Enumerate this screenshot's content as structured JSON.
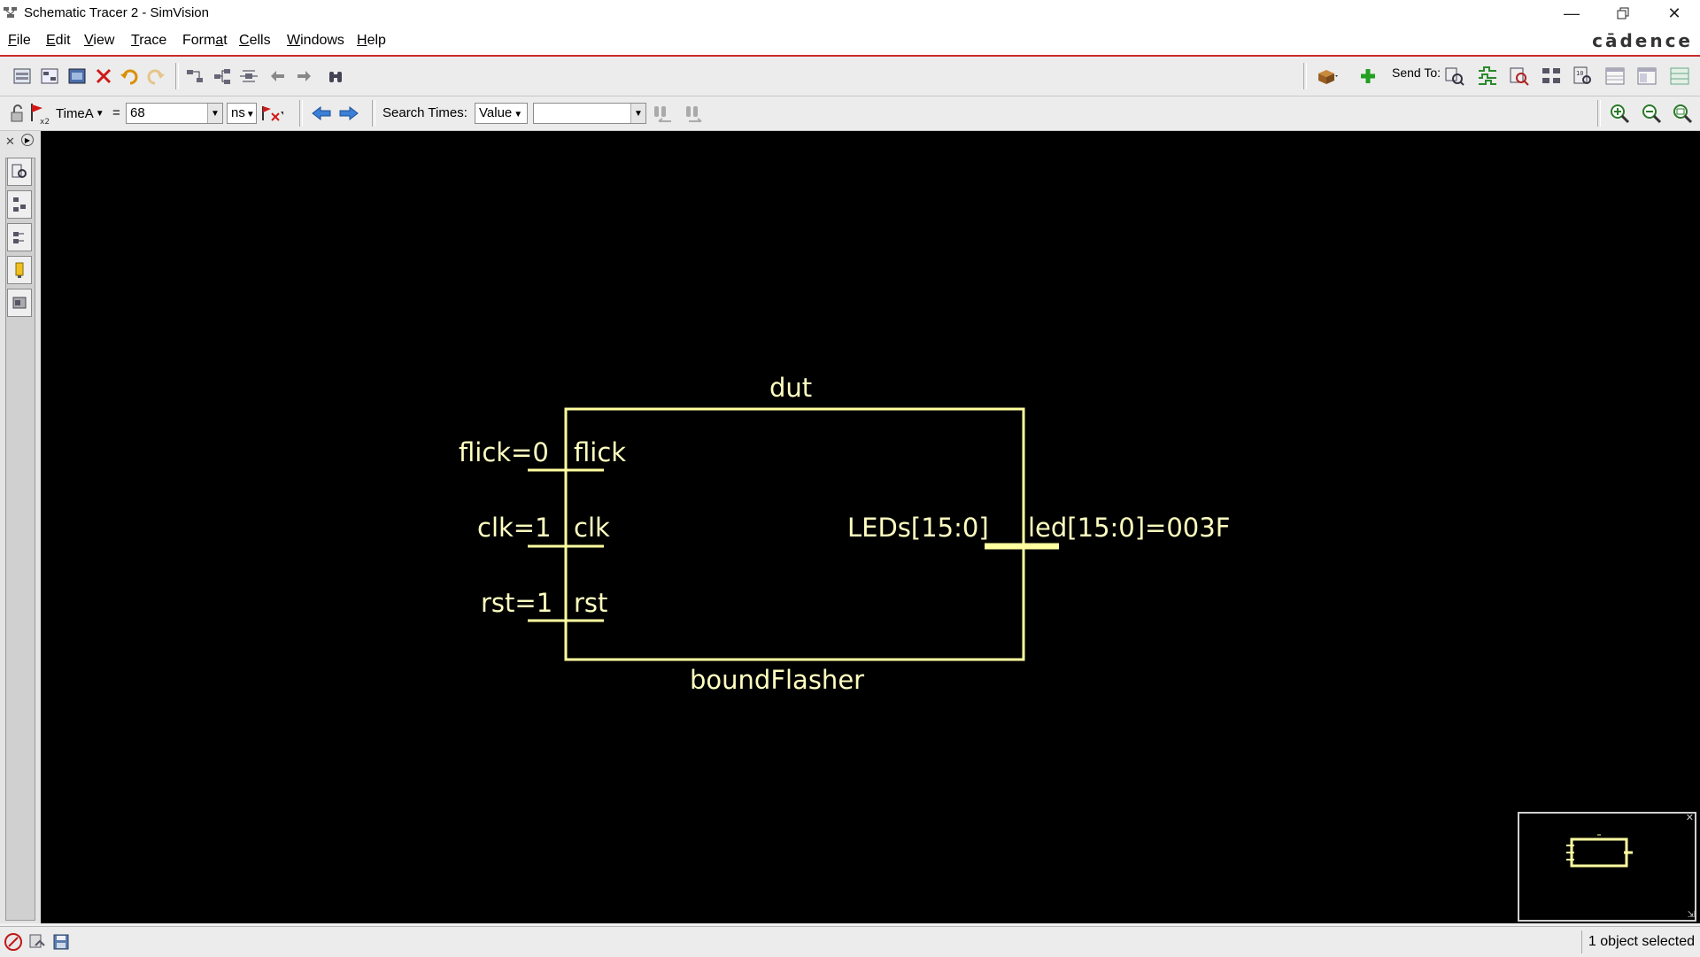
{
  "window": {
    "title": "Schematic Tracer 2 - SimVision",
    "controls": [
      "minimize-icon",
      "restore-icon",
      "close-icon"
    ]
  },
  "menu": [
    {
      "label": "File",
      "u": "F",
      "rest": "ile"
    },
    {
      "label": "Edit",
      "u": "E",
      "rest": "dit"
    },
    {
      "label": "View",
      "u": "V",
      "rest": "iew"
    },
    {
      "label": "Trace",
      "u": "T",
      "rest": "race"
    },
    {
      "label": "Format",
      "pre": "Form",
      "u": "a",
      "rest": "t"
    },
    {
      "label": "Cells",
      "u": "C",
      "rest": "ells"
    },
    {
      "label": "Windows",
      "u": "W",
      "rest": "indows"
    },
    {
      "label": "Help",
      "u": "H",
      "rest": "elp"
    }
  ],
  "brand": "cādence",
  "toolbar": {
    "send_to_label": "Send To:",
    "cursor_name": "TimeA",
    "equals": "=",
    "cursor_time": "68",
    "time_unit": "ns",
    "search_times_label": "Search Times:",
    "search_mode": "Value",
    "search_value": ""
  },
  "schematic": {
    "instance_name": "dut",
    "module_name": "boundFlasher",
    "inputs": [
      {
        "net_label": "flick=0",
        "port": "flick"
      },
      {
        "net_label": "clk=1",
        "port": "clk"
      },
      {
        "net_label": "rst=1",
        "port": "rst"
      }
    ],
    "outputs": [
      {
        "port": "LEDs[15:0]",
        "net_label": "led[15:0]=003F"
      }
    ],
    "wire_color": "#ffffa0"
  },
  "status": {
    "message": "1 object selected"
  }
}
